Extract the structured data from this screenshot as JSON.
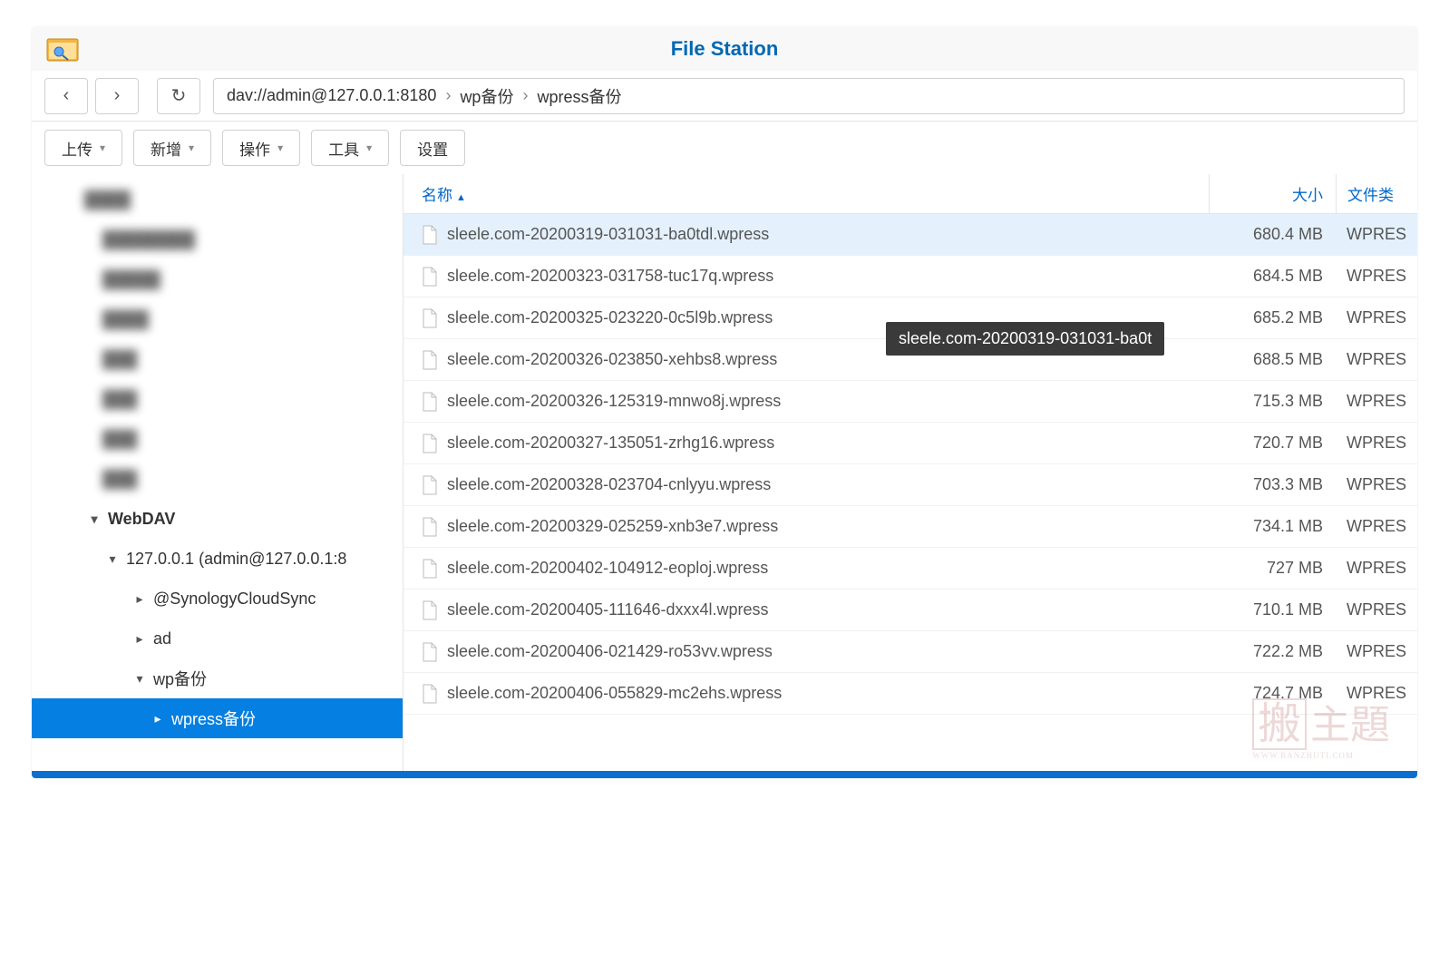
{
  "title": "File Station",
  "breadcrumb": {
    "root": "dav://admin@127.0.0.1:8180",
    "p1": "wp备份",
    "p2": "wpress备份"
  },
  "toolbar": {
    "upload": "上传",
    "add": "新增",
    "action": "操作",
    "tool": "工具",
    "settings": "设置"
  },
  "sidebar": {
    "blurred": [
      "",
      "",
      "",
      "",
      "",
      "",
      "",
      ""
    ],
    "webdav_label": "WebDAV",
    "host_label": "127.0.0.1 (admin@127.0.0.1:8",
    "items": {
      "cloudsync": "@SynologyCloudSync",
      "ad": "ad",
      "wpbak": "wp备份",
      "wpressbak": "wpress备份"
    }
  },
  "columns": {
    "name": "名称",
    "size": "大小",
    "type": "文件类"
  },
  "files": [
    {
      "name": "sleele.com-20200319-031031-ba0tdl.wpress",
      "size": "680.4 MB",
      "type": "WPRES",
      "selected": true
    },
    {
      "name": "sleele.com-20200323-031758-tuc17q.wpress",
      "size": "684.5 MB",
      "type": "WPRES"
    },
    {
      "name": "sleele.com-20200325-023220-0c5l9b.wpress",
      "size": "685.2 MB",
      "type": "WPRES"
    },
    {
      "name": "sleele.com-20200326-023850-xehbs8.wpress",
      "size": "688.5 MB",
      "type": "WPRES"
    },
    {
      "name": "sleele.com-20200326-125319-mnwo8j.wpress",
      "size": "715.3 MB",
      "type": "WPRES"
    },
    {
      "name": "sleele.com-20200327-135051-zrhg16.wpress",
      "size": "720.7 MB",
      "type": "WPRES"
    },
    {
      "name": "sleele.com-20200328-023704-cnlyyu.wpress",
      "size": "703.3 MB",
      "type": "WPRES"
    },
    {
      "name": "sleele.com-20200329-025259-xnb3e7.wpress",
      "size": "734.1 MB",
      "type": "WPRES"
    },
    {
      "name": "sleele.com-20200402-104912-eoploj.wpress",
      "size": "727 MB",
      "type": "WPRES"
    },
    {
      "name": "sleele.com-20200405-111646-dxxx4l.wpress",
      "size": "710.1 MB",
      "type": "WPRES"
    },
    {
      "name": "sleele.com-20200406-021429-ro53vv.wpress",
      "size": "722.2 MB",
      "type": "WPRES"
    },
    {
      "name": "sleele.com-20200406-055829-mc2ehs.wpress",
      "size": "724.7 MB",
      "type": "WPRES"
    }
  ],
  "tooltip": "sleele.com-20200319-031031-ba0t",
  "watermark": {
    "text1": "搬",
    "text2": "主題",
    "sub": "WWW.BANZHUTI.COM"
  }
}
